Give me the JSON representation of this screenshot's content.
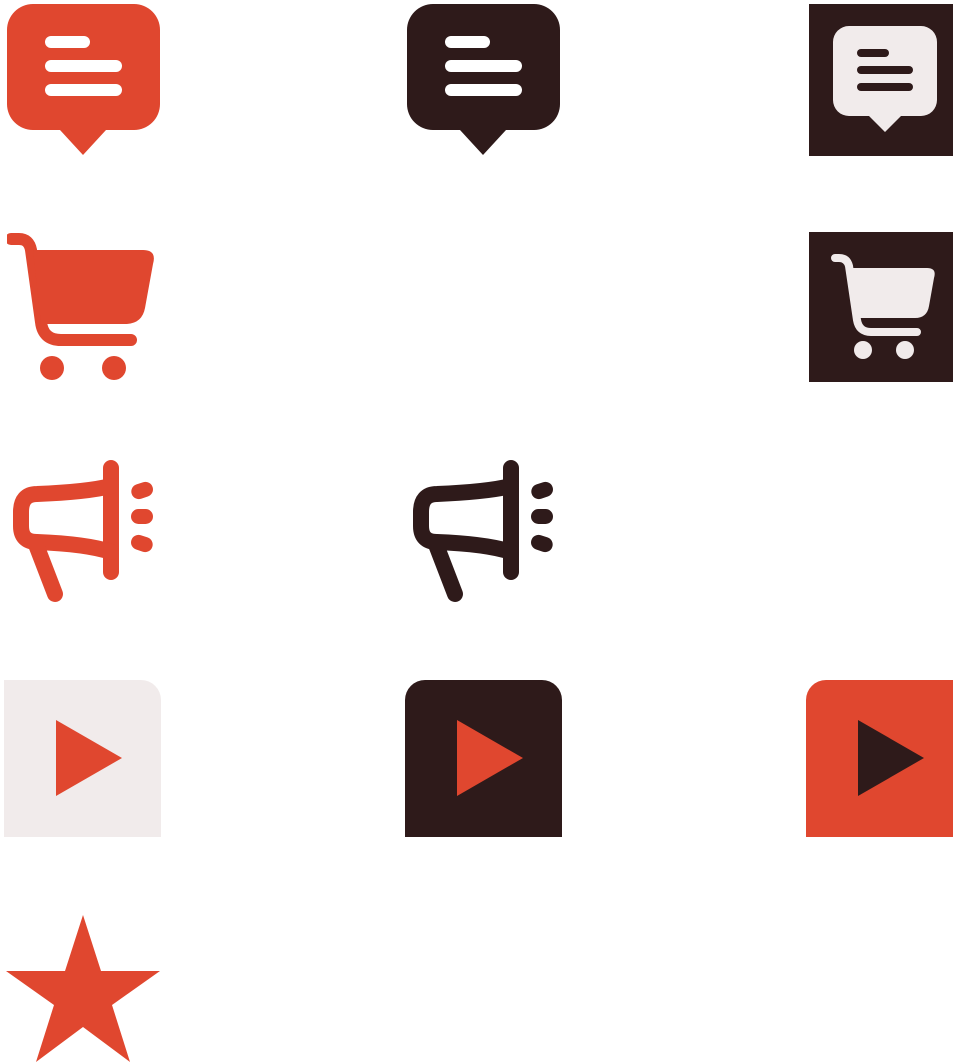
{
  "colors": {
    "red": "#E0472F",
    "dark": "#2E1A1A",
    "light": "#F1EBEB",
    "white": "#FFFFFF"
  },
  "icons": [
    {
      "id": "chat-red",
      "icon": "chat-bubble-icon",
      "variant": "red"
    },
    {
      "id": "chat-dark",
      "icon": "chat-bubble-icon",
      "variant": "dark"
    },
    {
      "id": "chat-inverse",
      "icon": "chat-bubble-icon",
      "variant": "light-on-dark-tile"
    },
    {
      "id": "cart-red",
      "icon": "shopping-cart-icon",
      "variant": "red"
    },
    {
      "id": "cart-inverse",
      "icon": "shopping-cart-icon",
      "variant": "light-on-dark-tile"
    },
    {
      "id": "megaphone-red",
      "icon": "megaphone-icon",
      "variant": "red"
    },
    {
      "id": "megaphone-dark",
      "icon": "megaphone-icon",
      "variant": "dark"
    },
    {
      "id": "play-light",
      "icon": "play-icon",
      "variant": "red-on-light-tile"
    },
    {
      "id": "play-dark",
      "icon": "play-icon",
      "variant": "red-on-dark-tile"
    },
    {
      "id": "play-red",
      "icon": "play-icon",
      "variant": "dark-on-red-tile"
    },
    {
      "id": "star-red",
      "icon": "star-icon",
      "variant": "red"
    }
  ]
}
